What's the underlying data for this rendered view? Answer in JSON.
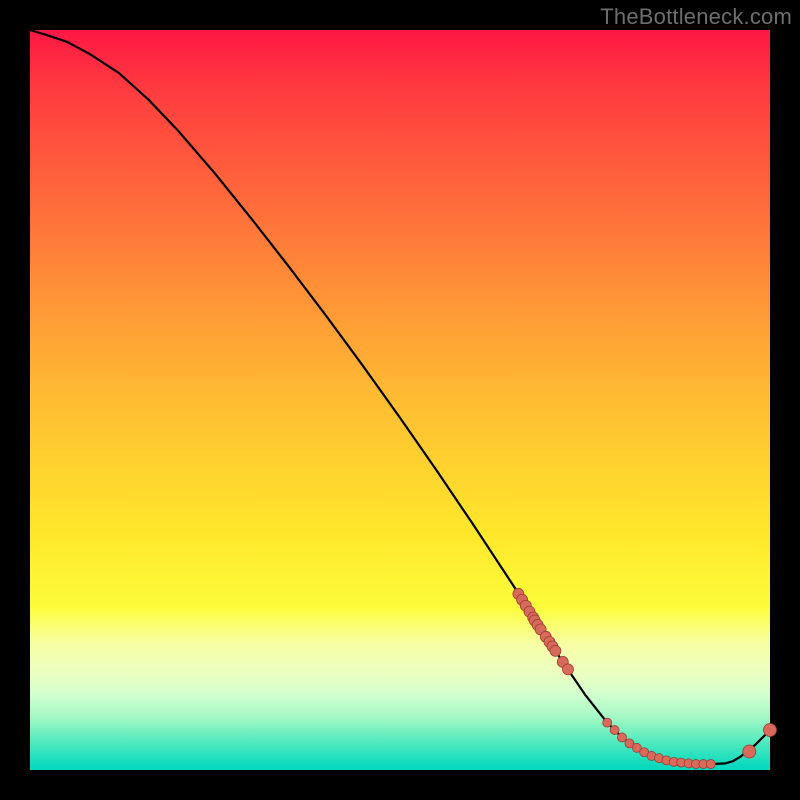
{
  "watermark": "TheBottleneck.com",
  "colors": {
    "background": "#000000",
    "curve": "#000000",
    "dot_fill": "#d86a5c",
    "dot_stroke": "#9c3e32"
  },
  "chart_data": {
    "type": "line",
    "title": "",
    "xlabel": "",
    "ylabel": "",
    "xlim": [
      0,
      100
    ],
    "ylim": [
      0,
      100
    ],
    "grid": false,
    "legend": false,
    "series": [
      {
        "name": "curve",
        "x": [
          0,
          2,
          5,
          8,
          12,
          16,
          20,
          25,
          30,
          35,
          40,
          45,
          50,
          55,
          60,
          65,
          68,
          70,
          72,
          75,
          78,
          80,
          82,
          85,
          88,
          90,
          92,
          94,
          95,
          96,
          98,
          100
        ],
        "y": [
          100,
          99.4,
          98.4,
          96.8,
          94.2,
          90.6,
          86.4,
          80.6,
          74.4,
          68.0,
          61.4,
          54.6,
          47.6,
          40.4,
          33.0,
          25.4,
          20.8,
          17.6,
          14.6,
          10.2,
          6.4,
          4.4,
          3.0,
          1.6,
          1.0,
          0.8,
          0.8,
          0.9,
          1.2,
          1.8,
          3.4,
          5.4
        ]
      }
    ],
    "clusters": [
      {
        "name": "upper-segment-dots",
        "points": [
          [
            66,
            23.8
          ],
          [
            66.5,
            23.0
          ],
          [
            67,
            22.2
          ],
          [
            67.5,
            21.4
          ],
          [
            68,
            20.6
          ],
          [
            68.2,
            20.2
          ],
          [
            68.6,
            19.6
          ],
          [
            69,
            19.0
          ],
          [
            69.7,
            18.0
          ],
          [
            70.2,
            17.3
          ],
          [
            70.6,
            16.7
          ],
          [
            71.0,
            16.1
          ],
          [
            72.0,
            14.6
          ],
          [
            72.7,
            13.6
          ]
        ],
        "radius": 5.5
      },
      {
        "name": "trough-dots",
        "points": [
          [
            78,
            6.4
          ],
          [
            79,
            5.4
          ],
          [
            80,
            4.4
          ],
          [
            81,
            3.6
          ],
          [
            82,
            3.0
          ],
          [
            83,
            2.4
          ],
          [
            84,
            1.9
          ],
          [
            85,
            1.6
          ],
          [
            86,
            1.3
          ],
          [
            87,
            1.1
          ],
          [
            88,
            1.0
          ],
          [
            89,
            0.9
          ],
          [
            90,
            0.8
          ],
          [
            91,
            0.8
          ],
          [
            92,
            0.8
          ]
        ],
        "radius": 4.5
      },
      {
        "name": "upturn-dots",
        "points": [
          [
            97.2,
            2.5
          ],
          [
            100,
            5.4
          ]
        ],
        "radius": 6.5
      }
    ]
  }
}
